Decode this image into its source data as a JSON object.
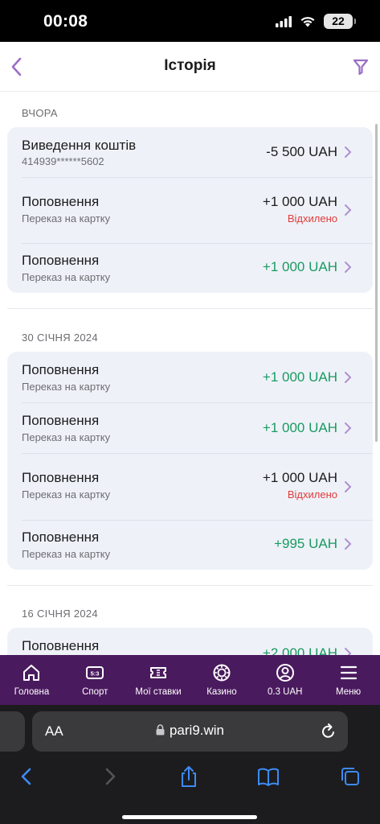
{
  "status_bar": {
    "time": "00:08",
    "battery": "22"
  },
  "header": {
    "title": "Історія"
  },
  "groups": [
    {
      "date": "ВЧОРА",
      "items": [
        {
          "title": "Виведення коштів",
          "subtitle": "414939******5602",
          "amount": "-5 500 UAH",
          "amount_color": "dark",
          "status": ""
        },
        {
          "title": "Поповнення",
          "subtitle": "Переказ на картку",
          "amount": "+1 000 UAH",
          "amount_color": "dark",
          "status": "Відхилено"
        },
        {
          "title": "Поповнення",
          "subtitle": "Переказ на картку",
          "amount": "+1 000 UAH",
          "amount_color": "green",
          "status": ""
        }
      ]
    },
    {
      "date": "30 СІЧНЯ 2024",
      "items": [
        {
          "title": "Поповнення",
          "subtitle": "Переказ на картку",
          "amount": "+1 000 UAH",
          "amount_color": "green",
          "status": ""
        },
        {
          "title": "Поповнення",
          "subtitle": "Переказ на картку",
          "amount": "+1 000 UAH",
          "amount_color": "green",
          "status": ""
        },
        {
          "title": "Поповнення",
          "subtitle": "Переказ на картку",
          "amount": "+1 000 UAH",
          "amount_color": "dark",
          "status": "Відхилено"
        },
        {
          "title": "Поповнення",
          "subtitle": "Переказ на картку",
          "amount": "+995 UAH",
          "amount_color": "green",
          "status": ""
        }
      ]
    },
    {
      "date": "16 СІЧНЯ 2024",
      "items": [
        {
          "title": "Поповнення",
          "subtitle": "",
          "amount": "+2 000 UAH",
          "amount_color": "green",
          "status": ""
        }
      ]
    }
  ],
  "bottom_nav": [
    {
      "label": "Головна",
      "icon": "home-icon"
    },
    {
      "label": "Спорт",
      "icon": "scoreboard-icon"
    },
    {
      "label": "Мої ставки",
      "icon": "ticket-icon"
    },
    {
      "label": "Казино",
      "icon": "casino-chip-icon"
    },
    {
      "label": "0.3 UAH",
      "icon": "account-icon"
    },
    {
      "label": "Меню",
      "icon": "menu-icon"
    }
  ],
  "browser": {
    "text_size_label": "AA",
    "url": "pari9.win"
  },
  "colors": {
    "accent": "#9b6fc4",
    "nav_bg": "#4a1a5e",
    "green": "#1a9a61",
    "red": "#e03a3a",
    "card_bg": "#eef2f8"
  }
}
